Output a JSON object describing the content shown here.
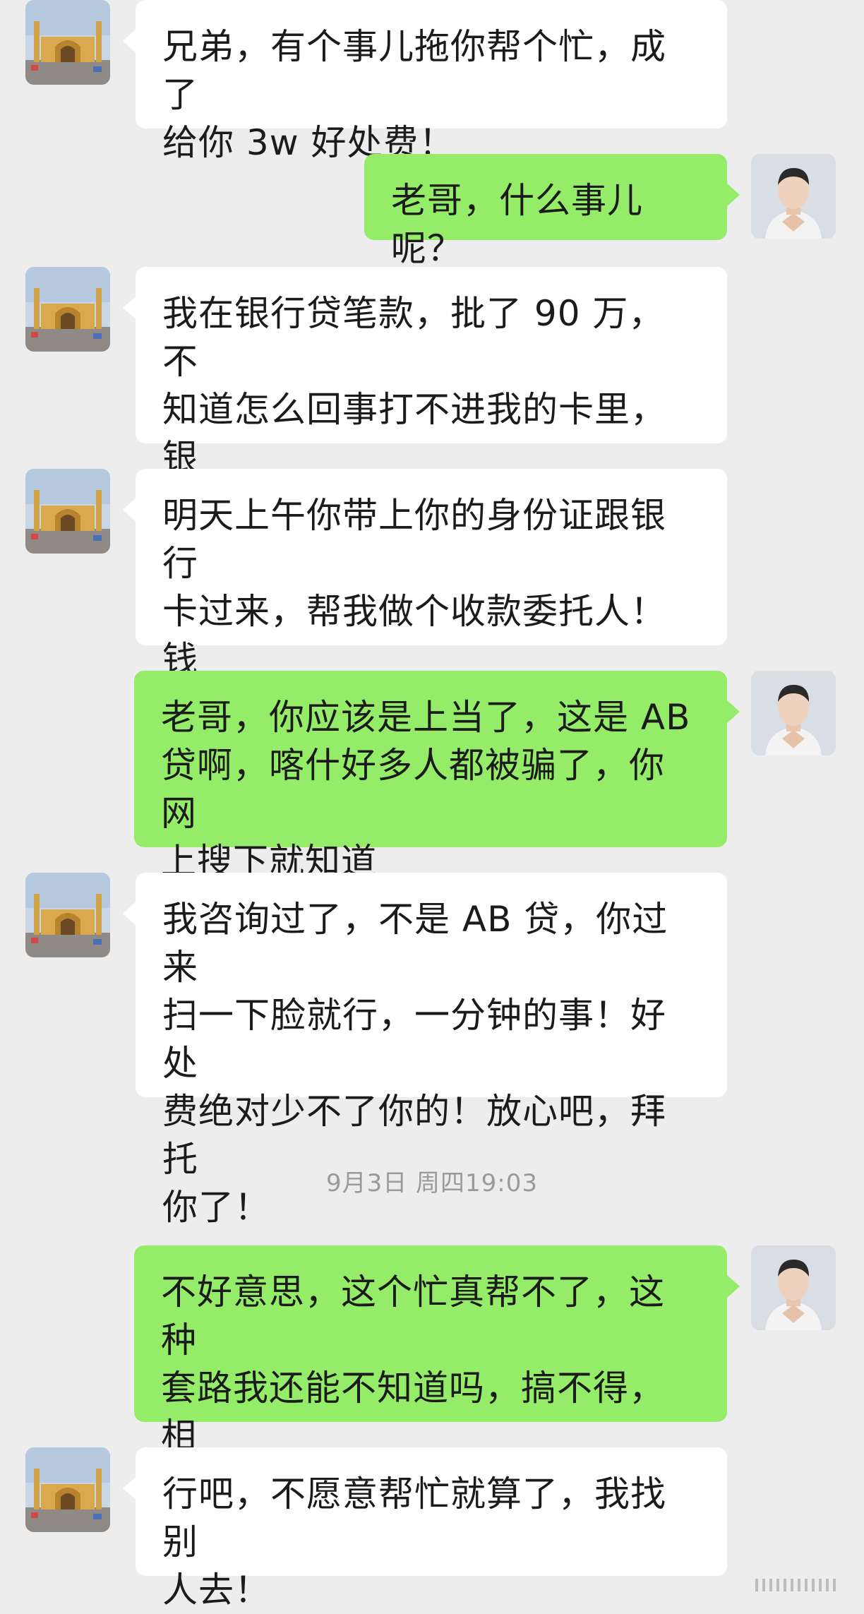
{
  "messages": [
    {
      "side": "in",
      "text": "兄弟，有个事儿拖你帮个忙，成了\n给你 3w 好处费！"
    },
    {
      "side": "out",
      "text": "老哥，什么事儿呢？"
    },
    {
      "side": "in",
      "text": "我在银行贷笔款，批了 90 万，不\n知道怎么回事打不进我的卡里，银\n行工作人员说也可以打到别人卡里"
    },
    {
      "side": "in",
      "text": "明天上午你带上你的身份证跟银行\n卡过来，帮我做个收款委托人！钱\n到账，我绝对不会亏待你"
    },
    {
      "side": "out",
      "text": "老哥，你应该是上当了，这是 AB\n贷啊，喀什好多人都被骗了，你网\n上搜下就知道"
    },
    {
      "side": "in",
      "text": "我咨询过了，不是 AB 贷，你过来\n扫一下脸就行，一分钟的事！好处\n费绝对少不了你的！放心吧，拜托\n你了！"
    },
    {
      "side": "out",
      "text": "不好意思，这个忙真帮不了，这种\n套路我还能不知道吗，搞不得，相\n信我"
    },
    {
      "side": "in",
      "text": "行吧，不愿意帮忙就算了，我找别\n人去！"
    }
  ],
  "timestamp": "9月3日 周四19:03",
  "avatars": {
    "contact": "mosque-photo-avatar",
    "self": "man-portrait-avatar"
  },
  "colors": {
    "background": "#ededed",
    "incoming_bubble": "#ffffff",
    "outgoing_bubble": "#95ec69",
    "timestamp_text": "#9a9a9a"
  }
}
